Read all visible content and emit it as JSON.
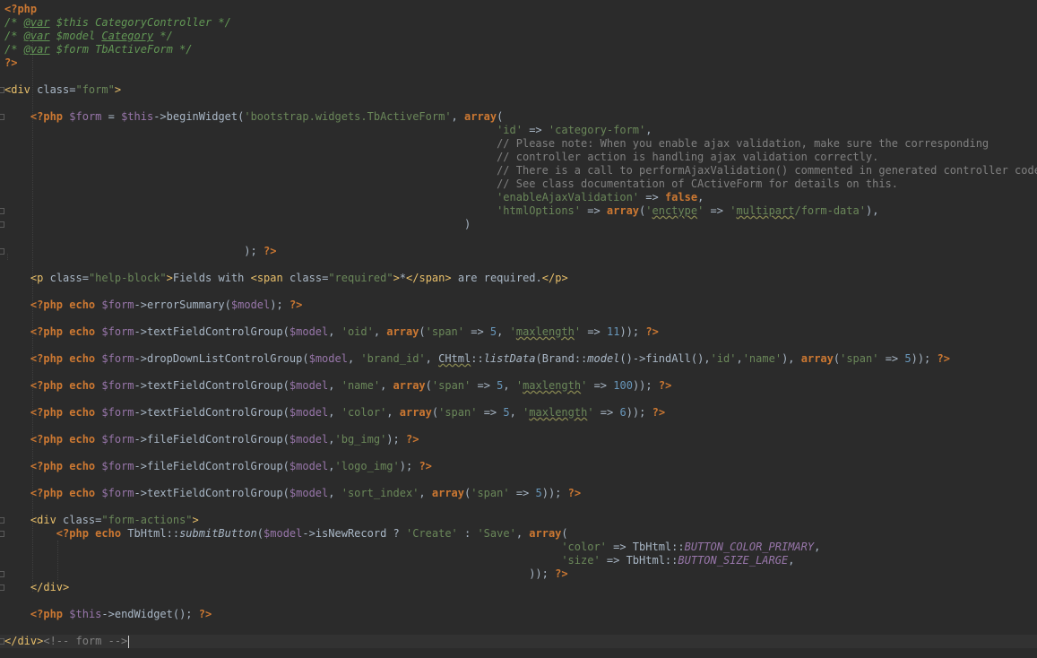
{
  "colors": {
    "background": "#2b2b2b",
    "current_line": "#323232",
    "keyword": "#cc7832",
    "string": "#6a8759",
    "variable": "#9876aa",
    "number": "#6897bb",
    "comment": "#808080",
    "doc_comment": "#629755",
    "tag": "#e8bf6a",
    "plain": "#a9b7c6"
  },
  "editor": {
    "language": "php",
    "lines": [
      [
        [
          "k",
          "<?php"
        ]
      ],
      [
        [
          "doc",
          "/* "
        ],
        [
          "doctag",
          "@var"
        ],
        [
          "doc",
          " $this CategoryController */"
        ]
      ],
      [
        [
          "doc",
          "/* "
        ],
        [
          "doctag",
          "@var"
        ],
        [
          "doc",
          " $model "
        ],
        [
          "doctag",
          "Category"
        ],
        [
          "doc",
          " */"
        ]
      ],
      [
        [
          "doc",
          "/* "
        ],
        [
          "doctag",
          "@var"
        ],
        [
          "doc",
          " $form TbActiveForm */"
        ]
      ],
      [
        [
          "k",
          "?>"
        ]
      ],
      [],
      [
        [
          "tag",
          "<div "
        ],
        [
          "p",
          "class="
        ],
        [
          "s",
          "\"form\""
        ],
        [
          "tag",
          ">"
        ]
      ],
      [],
      [
        [
          "p",
          "    "
        ],
        [
          "k",
          "<?php "
        ],
        [
          "v",
          "$form"
        ],
        [
          "p",
          " = "
        ],
        [
          "v",
          "$this"
        ],
        [
          "p",
          "->beginWidget("
        ],
        [
          "s",
          "'bootstrap.widgets.TbActiveForm'"
        ],
        [
          "p",
          ", "
        ],
        [
          "k",
          "array"
        ],
        [
          "p",
          "("
        ]
      ],
      [
        [
          "p",
          "                                                                            "
        ],
        [
          "s",
          "'id'"
        ],
        [
          "p",
          " => "
        ],
        [
          "s",
          "'category-form'"
        ],
        [
          "p",
          ","
        ]
      ],
      [
        [
          "p",
          "                                                                            "
        ],
        [
          "c",
          "// Please note: When you enable ajax validation, make sure the corresponding"
        ]
      ],
      [
        [
          "p",
          "                                                                            "
        ],
        [
          "c",
          "// controller action is handling ajax validation correctly."
        ]
      ],
      [
        [
          "p",
          "                                                                            "
        ],
        [
          "c",
          "// There is a call to performAjaxValidation() commented in generated controller code."
        ]
      ],
      [
        [
          "p",
          "                                                                            "
        ],
        [
          "c",
          "// See class documentation of CActiveForm for details on this."
        ]
      ],
      [
        [
          "p",
          "                                                                            "
        ],
        [
          "s",
          "'enableAjaxValidation'"
        ],
        [
          "p",
          " => "
        ],
        [
          "k",
          "false"
        ],
        [
          "p",
          ","
        ]
      ],
      [
        [
          "p",
          "                                                                            "
        ],
        [
          "s",
          "'htmlOptions'"
        ],
        [
          "p",
          " => "
        ],
        [
          "k",
          "array"
        ],
        [
          "p",
          "("
        ],
        [
          "s",
          "'"
        ],
        [
          "sw",
          "enctype"
        ],
        [
          "s",
          "'"
        ],
        [
          "p",
          " => "
        ],
        [
          "s",
          "'"
        ],
        [
          "sw",
          "multipart"
        ],
        [
          "s",
          "/form-data'"
        ],
        [
          "p",
          "),"
        ]
      ],
      [
        [
          "p",
          "                                                                       )"
        ]
      ],
      [],
      [
        [
          "p",
          "                                     ); "
        ],
        [
          "k",
          "?>"
        ]
      ],
      [],
      [
        [
          "p",
          "    "
        ],
        [
          "tag",
          "<p "
        ],
        [
          "p",
          "class="
        ],
        [
          "s",
          "\"help-block\""
        ],
        [
          "tag",
          ">"
        ],
        [
          "p",
          "Fields with "
        ],
        [
          "tag",
          "<span "
        ],
        [
          "p",
          "class="
        ],
        [
          "s",
          "\"required\""
        ],
        [
          "tag",
          ">"
        ],
        [
          "p",
          "*"
        ],
        [
          "tag",
          "</span>"
        ],
        [
          "p",
          " are required."
        ],
        [
          "tag",
          "</p>"
        ]
      ],
      [],
      [
        [
          "p",
          "    "
        ],
        [
          "k",
          "<?php echo "
        ],
        [
          "v",
          "$form"
        ],
        [
          "p",
          "->errorSummary("
        ],
        [
          "v",
          "$model"
        ],
        [
          "p",
          "); "
        ],
        [
          "k",
          "?>"
        ]
      ],
      [],
      [
        [
          "p",
          "    "
        ],
        [
          "k",
          "<?php echo "
        ],
        [
          "v",
          "$form"
        ],
        [
          "p",
          "->textFieldControlGroup("
        ],
        [
          "v",
          "$model"
        ],
        [
          "p",
          ", "
        ],
        [
          "s",
          "'oid'"
        ],
        [
          "p",
          ", "
        ],
        [
          "k",
          "array"
        ],
        [
          "p",
          "("
        ],
        [
          "s",
          "'span'"
        ],
        [
          "p",
          " => "
        ],
        [
          "n",
          "5"
        ],
        [
          "p",
          ", "
        ],
        [
          "s",
          "'"
        ],
        [
          "sw",
          "maxlength"
        ],
        [
          "s",
          "'"
        ],
        [
          "p",
          " => "
        ],
        [
          "n",
          "11"
        ],
        [
          "p",
          ")); "
        ],
        [
          "k",
          "?>"
        ]
      ],
      [],
      [
        [
          "p",
          "    "
        ],
        [
          "k",
          "<?php echo "
        ],
        [
          "v",
          "$form"
        ],
        [
          "p",
          "->dropDownListControlGroup("
        ],
        [
          "v",
          "$model"
        ],
        [
          "p",
          ", "
        ],
        [
          "s",
          "'brand_id'"
        ],
        [
          "p",
          ", "
        ],
        [
          "pw",
          "CHtml"
        ],
        [
          "p",
          "::"
        ],
        [
          "pi",
          "listData"
        ],
        [
          "p",
          "(Brand::"
        ],
        [
          "pi",
          "model"
        ],
        [
          "p",
          "()->findAll(),"
        ],
        [
          "s",
          "'id'"
        ],
        [
          "p",
          ","
        ],
        [
          "s",
          "'name'"
        ],
        [
          "p",
          "), "
        ],
        [
          "k",
          "array"
        ],
        [
          "p",
          "("
        ],
        [
          "s",
          "'span'"
        ],
        [
          "p",
          " => "
        ],
        [
          "n",
          "5"
        ],
        [
          "p",
          ")); "
        ],
        [
          "k",
          "?>"
        ]
      ],
      [],
      [
        [
          "p",
          "    "
        ],
        [
          "k",
          "<?php echo "
        ],
        [
          "v",
          "$form"
        ],
        [
          "p",
          "->textFieldControlGroup("
        ],
        [
          "v",
          "$model"
        ],
        [
          "p",
          ", "
        ],
        [
          "s",
          "'name'"
        ],
        [
          "p",
          ", "
        ],
        [
          "k",
          "array"
        ],
        [
          "p",
          "("
        ],
        [
          "s",
          "'span'"
        ],
        [
          "p",
          " => "
        ],
        [
          "n",
          "5"
        ],
        [
          "p",
          ", "
        ],
        [
          "s",
          "'"
        ],
        [
          "sw",
          "maxlength"
        ],
        [
          "s",
          "'"
        ],
        [
          "p",
          " => "
        ],
        [
          "n",
          "100"
        ],
        [
          "p",
          ")); "
        ],
        [
          "k",
          "?>"
        ]
      ],
      [],
      [
        [
          "p",
          "    "
        ],
        [
          "k",
          "<?php echo "
        ],
        [
          "v",
          "$form"
        ],
        [
          "p",
          "->textFieldControlGroup("
        ],
        [
          "v",
          "$model"
        ],
        [
          "p",
          ", "
        ],
        [
          "s",
          "'color'"
        ],
        [
          "p",
          ", "
        ],
        [
          "k",
          "array"
        ],
        [
          "p",
          "("
        ],
        [
          "s",
          "'span'"
        ],
        [
          "p",
          " => "
        ],
        [
          "n",
          "5"
        ],
        [
          "p",
          ", "
        ],
        [
          "s",
          "'"
        ],
        [
          "sw",
          "maxlength"
        ],
        [
          "s",
          "'"
        ],
        [
          "p",
          " => "
        ],
        [
          "n",
          "6"
        ],
        [
          "p",
          ")); "
        ],
        [
          "k",
          "?>"
        ]
      ],
      [],
      [
        [
          "p",
          "    "
        ],
        [
          "k",
          "<?php echo "
        ],
        [
          "v",
          "$form"
        ],
        [
          "p",
          "->fileFieldControlGroup("
        ],
        [
          "v",
          "$model"
        ],
        [
          "p",
          ","
        ],
        [
          "s",
          "'bg_img'"
        ],
        [
          "p",
          "); "
        ],
        [
          "k",
          "?>"
        ]
      ],
      [],
      [
        [
          "p",
          "    "
        ],
        [
          "k",
          "<?php echo "
        ],
        [
          "v",
          "$form"
        ],
        [
          "p",
          "->fileFieldControlGroup("
        ],
        [
          "v",
          "$model"
        ],
        [
          "p",
          ","
        ],
        [
          "s",
          "'logo_img'"
        ],
        [
          "p",
          "); "
        ],
        [
          "k",
          "?>"
        ]
      ],
      [],
      [
        [
          "p",
          "    "
        ],
        [
          "k",
          "<?php echo "
        ],
        [
          "v",
          "$form"
        ],
        [
          "p",
          "->textFieldControlGroup("
        ],
        [
          "v",
          "$model"
        ],
        [
          "p",
          ", "
        ],
        [
          "s",
          "'sort_index'"
        ],
        [
          "p",
          ", "
        ],
        [
          "k",
          "array"
        ],
        [
          "p",
          "("
        ],
        [
          "s",
          "'span'"
        ],
        [
          "p",
          " => "
        ],
        [
          "n",
          "5"
        ],
        [
          "p",
          ")); "
        ],
        [
          "k",
          "?>"
        ]
      ],
      [],
      [
        [
          "p",
          "    "
        ],
        [
          "tag",
          "<div "
        ],
        [
          "p",
          "class="
        ],
        [
          "s",
          "\"form-actions\""
        ],
        [
          "tag",
          ">"
        ]
      ],
      [
        [
          "p",
          "        "
        ],
        [
          "k",
          "<?php echo "
        ],
        [
          "p",
          "TbHtml::"
        ],
        [
          "pi",
          "submitButton"
        ],
        [
          "p",
          "("
        ],
        [
          "v",
          "$model"
        ],
        [
          "p",
          "->isNewRecord ? "
        ],
        [
          "s",
          "'Create'"
        ],
        [
          "p",
          " : "
        ],
        [
          "s",
          "'Save'"
        ],
        [
          "p",
          ", "
        ],
        [
          "k",
          "array"
        ],
        [
          "p",
          "("
        ]
      ],
      [
        [
          "p",
          "                                                                                      "
        ],
        [
          "s",
          "'color'"
        ],
        [
          "p",
          " => TbHtml::"
        ],
        [
          "vi",
          "BUTTON_COLOR_PRIMARY"
        ],
        [
          "p",
          ","
        ]
      ],
      [
        [
          "p",
          "                                                                                      "
        ],
        [
          "s",
          "'size'"
        ],
        [
          "p",
          " => TbHtml::"
        ],
        [
          "vi",
          "BUTTON_SIZE_LARGE"
        ],
        [
          "p",
          ","
        ]
      ],
      [
        [
          "p",
          "                                                                                 )); "
        ],
        [
          "k",
          "?>"
        ]
      ],
      [
        [
          "p",
          "    "
        ],
        [
          "tag",
          "</div>"
        ]
      ],
      [],
      [
        [
          "p",
          "    "
        ],
        [
          "k",
          "<?php "
        ],
        [
          "v",
          "$this"
        ],
        [
          "p",
          "->endWidget(); "
        ],
        [
          "k",
          "?>"
        ]
      ],
      [],
      [
        [
          "tag",
          "</div>"
        ],
        [
          "c",
          "<!-- form -->"
        ]
      ]
    ]
  }
}
